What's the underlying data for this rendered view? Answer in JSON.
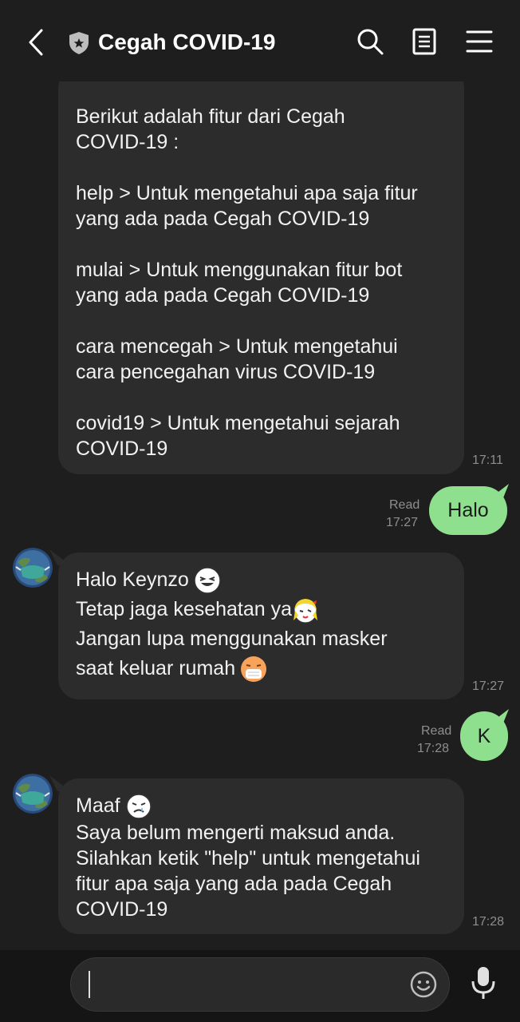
{
  "header": {
    "title": "Cegah COVID-19",
    "icons": [
      "back-icon",
      "shield-icon",
      "search-icon",
      "notes-icon",
      "menu-icon"
    ]
  },
  "messages": {
    "m1": {
      "lines": [
        "Berikut adalah fitur dari Cegah",
        "COVID-19 :",
        "",
        "help > Untuk mengetahui apa saja fitur",
        "yang ada pada Cegah COVID-19",
        "",
        "mulai > Untuk menggunakan fitur bot",
        "yang ada pada Cegah COVID-19",
        "",
        "cara mencegah > Untuk mengetahui",
        "cara pencegahan virus COVID-19",
        "",
        "covid19 > Untuk mengetahui sejarah",
        "COVID-19"
      ],
      "time": "17:11"
    },
    "m2": {
      "text": "Halo",
      "read": "Read",
      "time": "17:27"
    },
    "m3": {
      "line1": "Halo Keynzo",
      "line2": "Tetap jaga kesehatan ya",
      "line3": "Jangan lupa menggunakan masker",
      "line4": "saat keluar rumah",
      "time": "17:27"
    },
    "m4": {
      "text": "K",
      "read": "Read",
      "time": "17:28"
    },
    "m5": {
      "line1": "Maaf",
      "line2": "Saya belum mengerti maksud anda.",
      "line3": "Silahkan ketik \"help\" untuk mengetahui",
      "line4": "fitur apa saja yang ada pada Cegah",
      "line5": "COVID-19",
      "time": "17:28"
    }
  },
  "composer": {
    "value": "",
    "icons": [
      "expand-icon",
      "emoji-icon",
      "microphone-icon"
    ]
  },
  "colors": {
    "background": "#1e1e1e",
    "incoming_bubble": "#2c2c2c",
    "outgoing_bubble": "#8fe08e",
    "timestamp": "#8e8e8e"
  }
}
